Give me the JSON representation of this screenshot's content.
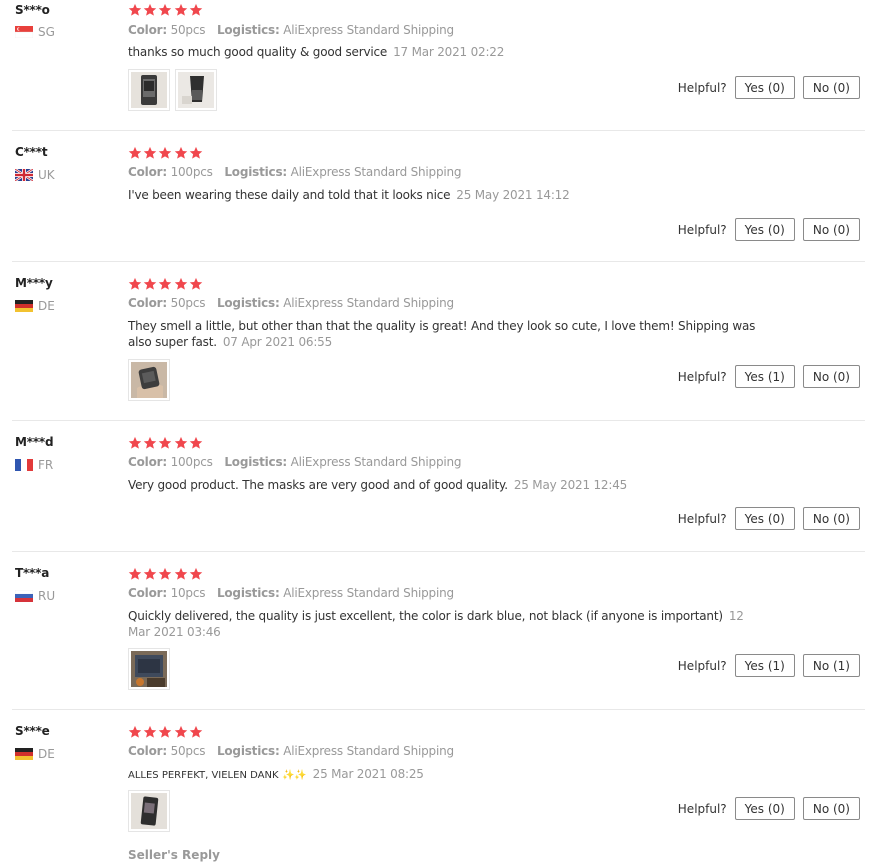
{
  "helpful_label": "Helpful?",
  "colors": {
    "star": "#f0474d",
    "muted": "#999999",
    "border": "#e8e8e8"
  },
  "reviews": [
    {
      "user": "S***o",
      "country": "SG",
      "flag": "sg",
      "rating": 5,
      "color_label": "Color:",
      "color_value": "50pcs",
      "logistics_label": "Logistics:",
      "logistics_value": "AliExpress Standard Shipping",
      "text": "thanks so much good quality & good service",
      "date": "17 Mar 2021 02:22",
      "photos": [
        "photo-mask-pack",
        "photo-mask-black"
      ],
      "yes": "Yes (0)",
      "no": "No (0)"
    },
    {
      "user": "C***t",
      "country": "UK",
      "flag": "uk",
      "rating": 5,
      "color_label": "Color:",
      "color_value": "100pcs",
      "logistics_label": "Logistics:",
      "logistics_value": "AliExpress Standard Shipping",
      "text": "I've been wearing these daily and told that it looks nice",
      "date": "25 May 2021 14:12",
      "photos": [],
      "yes": "Yes (0)",
      "no": "No (0)"
    },
    {
      "user": "M***y",
      "country": "DE",
      "flag": "de",
      "rating": 5,
      "color_label": "Color:",
      "color_value": "50pcs",
      "logistics_label": "Logistics:",
      "logistics_value": "AliExpress Standard Shipping",
      "text": "They smell a little, but other than that the quality is great! And they look so cute, I love them! Shipping was also super fast.",
      "date": "07 Apr 2021 06:55",
      "photos": [
        "photo-mask-hand"
      ],
      "yes": "Yes (1)",
      "no": "No (0)"
    },
    {
      "user": "M***d",
      "country": "FR",
      "flag": "fr",
      "rating": 5,
      "color_label": "Color:",
      "color_value": "100pcs",
      "logistics_label": "Logistics:",
      "logistics_value": "AliExpress Standard Shipping",
      "text": "Very good product. The masks are very good and of good quality.",
      "date": "25 May 2021 12:45",
      "photos": [],
      "yes": "Yes (0)",
      "no": "No (0)"
    },
    {
      "user": "T***a",
      "country": "RU",
      "flag": "ru",
      "rating": 5,
      "color_label": "Color:",
      "color_value": "10pcs",
      "logistics_label": "Logistics:",
      "logistics_value": "AliExpress Standard Shipping",
      "text": "Quickly delivered, the quality is just excellent, the color is dark blue, not black (if anyone is important)",
      "date": "12 Mar 2021 03:46",
      "photos": [
        "photo-mask-dark"
      ],
      "yes": "Yes (1)",
      "no": "No (1)"
    },
    {
      "user": "S***e",
      "country": "DE",
      "flag": "de",
      "rating": 5,
      "color_label": "Color:",
      "color_value": "50pcs",
      "logistics_label": "Logistics:",
      "logistics_value": "AliExpress Standard Shipping",
      "text": "ALLES PERFEKT, VIELEN DANK",
      "sparkles": "✨✨",
      "date": "25 Mar 2021 08:25",
      "photos": [
        "photo-mask-single"
      ],
      "yes": "Yes (0)",
      "no": "No (0)"
    }
  ],
  "seller_reply_label": "Seller's Reply"
}
